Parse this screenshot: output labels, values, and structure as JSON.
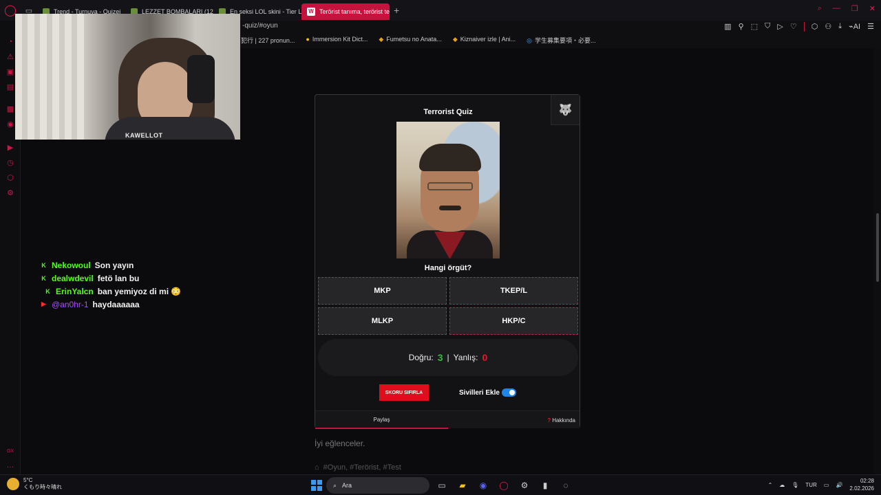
{
  "browser": {
    "tabs": [
      {
        "label": "Trend - Turnuva - Quizei",
        "active": false
      },
      {
        "label": "LEZZET BOMBALARI (128",
        "active": false
      },
      {
        "label": "En seksi LOL skini - Tier L",
        "active": false
      },
      {
        "label": "Terörist tanıma, terörist te",
        "active": true
      }
    ],
    "url": "-quiz/#oyun",
    "bookmarks": [
      "犯行 | 227 pronun...",
      "Immersion Kit Dict...",
      "Fumetsu no Anata...",
      "Kiznaiver izle | Ani...",
      "学生募集要項・必要..."
    ],
    "ai_label": "AI"
  },
  "stream": {
    "webcam_label": "KAWELLOT",
    "chat": [
      {
        "platform": "kick",
        "user": "Nekowoul",
        "user_color": "#53fc18",
        "message": "Son yayın"
      },
      {
        "platform": "kick",
        "user": "dealwdevil",
        "user_color": "#53fc18",
        "message": "fetö lan bu"
      },
      {
        "platform": "kick",
        "user": "ErinYalcn",
        "user_color": "#53fc18",
        "message": "ban yemiyoz di mi 😳"
      },
      {
        "platform": "youtube",
        "user": "@an0hr-1",
        "user_color": "#a64dff",
        "message": "haydaaaaaa"
      }
    ]
  },
  "quiz": {
    "title": "Terrorist Quiz",
    "question": "Hangi örgüt?",
    "answers": [
      "MKP",
      "TKEP/L",
      "MLKP",
      "HKP/C"
    ],
    "score": {
      "correct_label": "Doğru:",
      "correct": "3",
      "separator": "|",
      "wrong_label": "Yanlış:",
      "wrong": "0"
    },
    "reset_label": "SKORU SIFIRLA",
    "civilians_label": "Sivilleri Ekle",
    "civilians_enabled": true,
    "share_label": "Paylaş",
    "about_label": "Hakkında"
  },
  "page": {
    "below_text": "İyi eğlenceler.",
    "tags": "#Oyun, #Terörist, #Test"
  },
  "taskbar": {
    "weather_temp": "5°C",
    "weather_desc": "くもり時々晴れ",
    "search_label": "Ara",
    "lang": "TUR",
    "time": "02:28",
    "date": "2.02.2026"
  },
  "colors": {
    "accent": "#c4143e",
    "correct": "#2fbf3a",
    "wrong": "#e0192f",
    "reset": "#e00d1c",
    "toggle": "#1f86e6"
  }
}
